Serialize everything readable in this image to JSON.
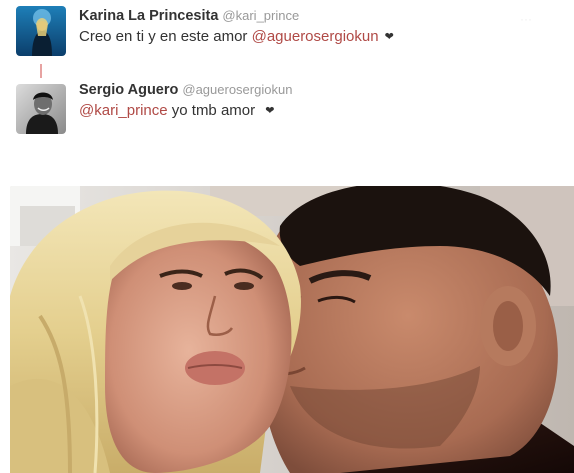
{
  "thread": {
    "tweets": [
      {
        "fullname": "Karina La Princesita",
        "username": "@kari_prince",
        "text_before": "Creo en ti y en este amor ",
        "mention": "@aguerosergiokun",
        "heart": "❤",
        "avatar_icon": "avatar-icon"
      },
      {
        "fullname": "Sergio Aguero",
        "username": "@aguerosergiokun",
        "mention": "@kari_prince",
        "text_after": " yo tmb amor ",
        "heart": "❤",
        "avatar_icon": "avatar-icon"
      }
    ]
  },
  "colors": {
    "mention": "#b04a46",
    "name": "#333333",
    "username": "#999999",
    "thread_line": "#e7a3a2"
  }
}
